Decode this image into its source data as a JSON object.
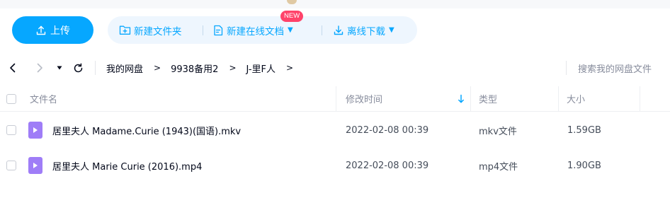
{
  "toolbar": {
    "upload_label": "上传",
    "new_folder_label": "新建文件夹",
    "new_online_doc_label": "新建在线文档",
    "new_badge": "NEW",
    "offline_download_label": "离线下载"
  },
  "breadcrumb": {
    "items": [
      "我的网盘",
      "9938备用2",
      "J-里F人"
    ],
    "separator": ">"
  },
  "search": {
    "placeholder": "搜索我的网盘文件"
  },
  "table": {
    "columns": {
      "name": "文件名",
      "modified": "修改时间",
      "type": "类型",
      "size": "大小"
    },
    "sort": {
      "column": "modified",
      "direction": "desc"
    },
    "rows": [
      {
        "name": "居里夫人 Madame.Curie (1943)(国语).mkv",
        "modified": "2022-02-08 00:39",
        "type": "mkv文件",
        "size": "1.59GB",
        "icon": "video-file-icon"
      },
      {
        "name": "居里夫人 Marie Curie (2016).mp4",
        "modified": "2022-02-08 00:39",
        "type": "mp4文件",
        "size": "1.90GB",
        "icon": "video-file-icon"
      }
    ]
  },
  "colors": {
    "accent": "#06a7ff",
    "accent_bg": "#eef6fe",
    "badge": "#ff436a",
    "video_icon": "#9f7df7",
    "muted_text": "#878c9c"
  }
}
